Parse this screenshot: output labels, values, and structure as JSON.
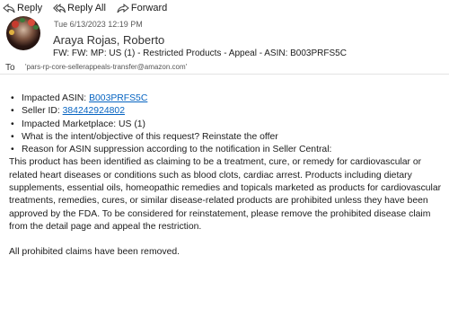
{
  "toolbar": {
    "reply_label": "Reply",
    "reply_all_label": "Reply All",
    "forward_label": "Forward"
  },
  "message": {
    "date": "Tue 6/13/2023 12:19 PM",
    "sender": "Araya Rojas, Roberto",
    "subject": "FW: FW: MP: US (1) - Restricted Products - Appeal - ASIN:   B003PRFS5C",
    "to_label": "To",
    "to_address": "'pars-rp-core-sellerappeals-transfer@amazon.com'"
  },
  "body": {
    "bullets": [
      {
        "label": "Impacted ASIN: ",
        "link": "B003PRFS5C"
      },
      {
        "label": "Seller ID: ",
        "link": "384242924802"
      },
      {
        "label": "Impacted Marketplace: US (1)"
      },
      {
        "label": "What is the intent/objective of this request? Reinstate the offer"
      },
      {
        "label": "Reason for ASIN suppression according to the notification in Seller Central:"
      }
    ],
    "paragraph": "This product has been identified as claiming to be a treatment, cure, or remedy for cardiovascular or related heart diseases or conditions such as blood clots, cardiac arrest. Products including dietary supplements, essential oils, homeopathic remedies and topicals marketed as products for cardiovascular treatments, remedies, cures, or similar disease-related products are prohibited unless they have been approved by the FDA. To be considered for reinstatement, please remove the prohibited disease claim from the detail page and appeal the restriction.",
    "closing": "All prohibited claims have been removed."
  }
}
